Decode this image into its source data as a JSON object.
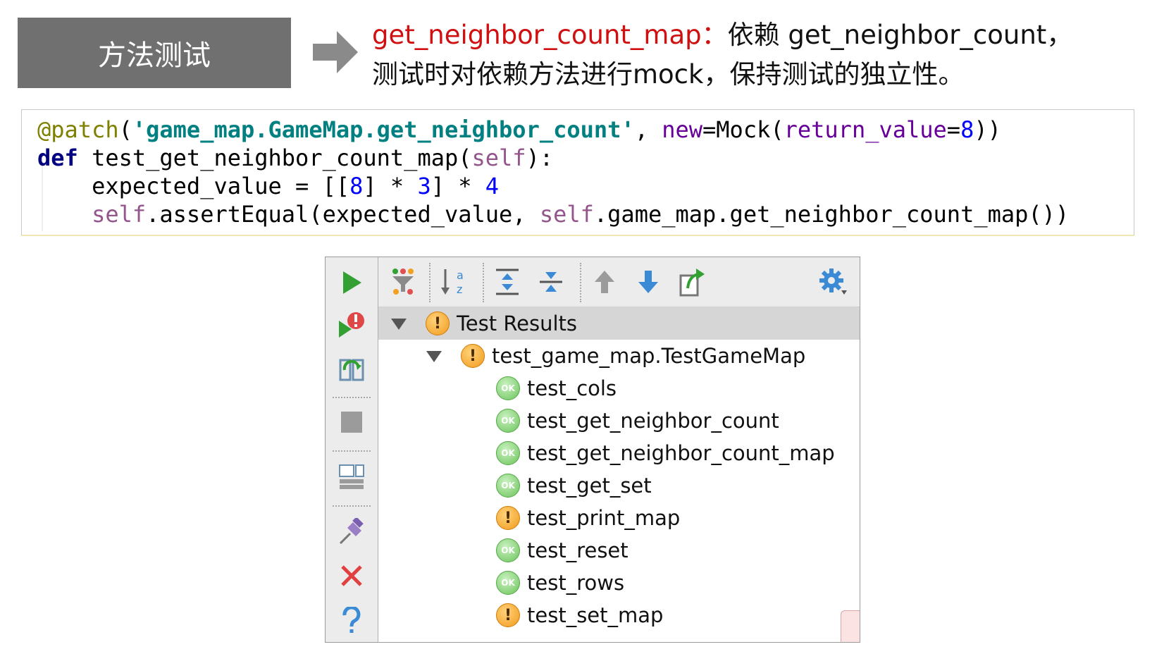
{
  "slide": {
    "title": "方法测试",
    "desc_highlight": "get_neighbor_count_map：",
    "desc_rest_line1": "依赖 get_neighbor_count，",
    "desc_line2": "测试时对依赖方法进行mock，保持测试的独立性。"
  },
  "code": {
    "decorator_at": "@",
    "decorator_name": "patch",
    "decorator_open": "(",
    "decorator_target": "'game_map.GameMap.get_neighbor_count'",
    "comma": ", ",
    "kw_new": "new",
    "eq_mock": "=Mock(",
    "kw_return_value": "return_value",
    "eq": "=",
    "num_8": "8",
    "close2": "))",
    "kw_def": "def",
    "func_sig_a": " test_get_neighbor_count_map(",
    "self": "self",
    "func_sig_b": "):",
    "line3_a": "    expected_value = [[",
    "line3_b": "] * ",
    "num_3": "3",
    "line3_c": "] * ",
    "num_4": "4",
    "line4_indent": "    ",
    "line4_a": ".assertEqual(expected_value, ",
    "line4_b": ".game_map.get_neighbor_count_map())"
  },
  "runner": {
    "sidebar_icons": [
      "run-icon",
      "rerun-failed-icon",
      "toggle-auto-test-icon",
      "stop-icon",
      "layout-icon",
      "pin-icon",
      "close-icon",
      "help-icon"
    ],
    "toolbar_icons": [
      "filter-icon",
      "sort-alpha-icon",
      "expand-all-icon",
      "collapse-all-icon",
      "previous-icon",
      "next-icon",
      "export-icon",
      "settings-gear-icon"
    ],
    "ok_label": "OK",
    "warn_label": "!",
    "colors": {
      "ok": "#6cc35c",
      "warn": "#f29b1d",
      "run": "#33a033",
      "close": "#e04040",
      "blue": "#3a8ad6"
    },
    "root": {
      "label": "Test Results",
      "status": "warn"
    },
    "suite": {
      "label": "test_game_map.TestGameMap",
      "status": "warn"
    },
    "tests": [
      {
        "label": "test_cols",
        "status": "ok"
      },
      {
        "label": "test_get_neighbor_count",
        "status": "ok"
      },
      {
        "label": "test_get_neighbor_count_map",
        "status": "ok"
      },
      {
        "label": "test_get_set",
        "status": "ok"
      },
      {
        "label": "test_print_map",
        "status": "warn"
      },
      {
        "label": "test_reset",
        "status": "ok"
      },
      {
        "label": "test_rows",
        "status": "ok"
      },
      {
        "label": "test_set_map",
        "status": "warn"
      }
    ]
  }
}
